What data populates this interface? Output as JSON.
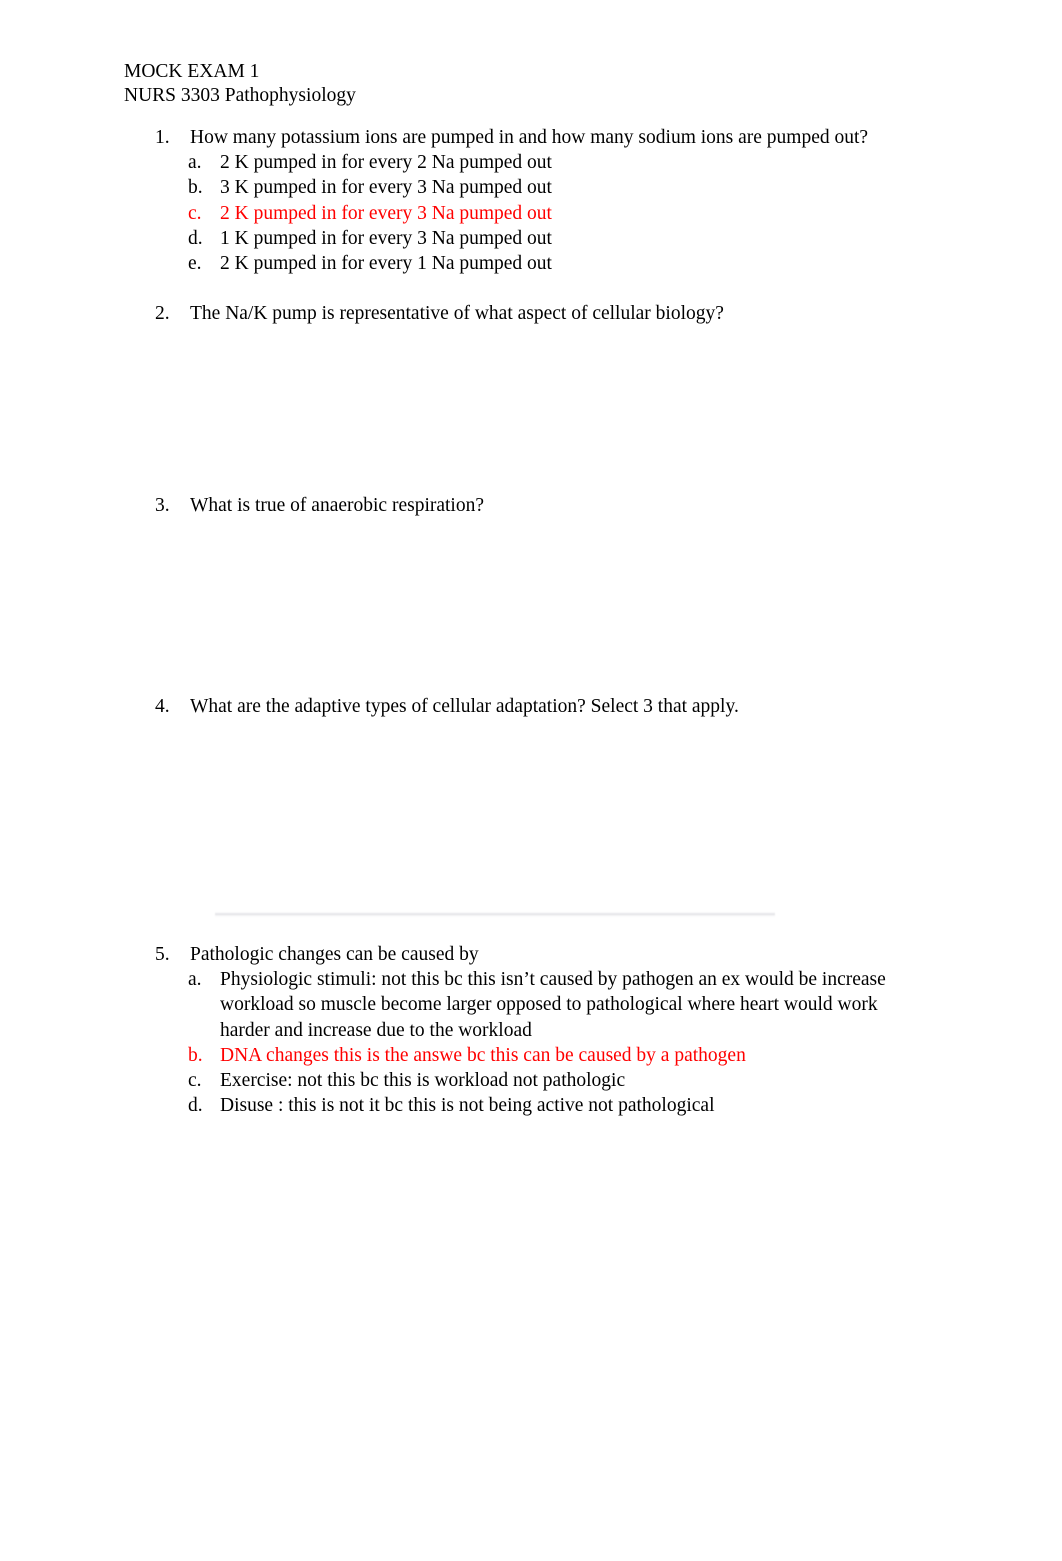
{
  "document": {
    "header": {
      "line1": "MOCK EXAM 1",
      "line2": "NURS 3303 Pathophysiology"
    },
    "accent_red": "#ff0000",
    "text_color": "#000000",
    "background": "#ffffff"
  },
  "questions": [
    {
      "number": "1.",
      "text": "How many potassium ions are pumped in and how many sodium ions are pumped out?",
      "options": [
        {
          "letter": "a.",
          "text": "2 K pumped in for every 2 Na pumped out",
          "highlighted": false
        },
        {
          "letter": "b.",
          "text": "3 K pumped in for every 3 Na pumped out",
          "highlighted": false
        },
        {
          "letter": "c.",
          "text": "2 K pumped in for every 3 Na pumped out",
          "highlighted": true
        },
        {
          "letter": "d.",
          "text": "1 K pumped in for every 3 Na pumped out",
          "highlighted": false
        },
        {
          "letter": "e.",
          "text": "2 K pumped in for every 1 Na pumped out",
          "highlighted": false
        }
      ]
    },
    {
      "number": "2.",
      "text": "The Na/K pump is representative of what aspect of cellular biology?",
      "options": []
    },
    {
      "number": "3.",
      "text": "What is true of anaerobic respiration?",
      "options": []
    },
    {
      "number": "4.",
      "text": "What are the adaptive types of cellular adaptation? Select 3 that apply.",
      "options": []
    },
    {
      "number": "5.",
      "text": "Pathologic changes can be caused by",
      "options": [
        {
          "letter": "a.",
          "text": "Physiologic stimuli: not this bc this isn’t caused by pathogen an ex would be increase workload so muscle become larger opposed to pathological where heart would work harder and increase due to the workload",
          "highlighted": false
        },
        {
          "letter": "b.",
          "text": "DNA changes this is the answe bc this can be caused by a pathogen",
          "highlighted": true
        },
        {
          "letter": "c.",
          "text": "Exercise: not this bc this is workload not pathologic",
          "highlighted": false
        },
        {
          "letter": "d.",
          "text": "Disuse : this is not it bc this is not being active not pathological",
          "highlighted": false
        }
      ]
    }
  ],
  "layout": {
    "question_tops": [
      125,
      301,
      493,
      694,
      942
    ]
  }
}
